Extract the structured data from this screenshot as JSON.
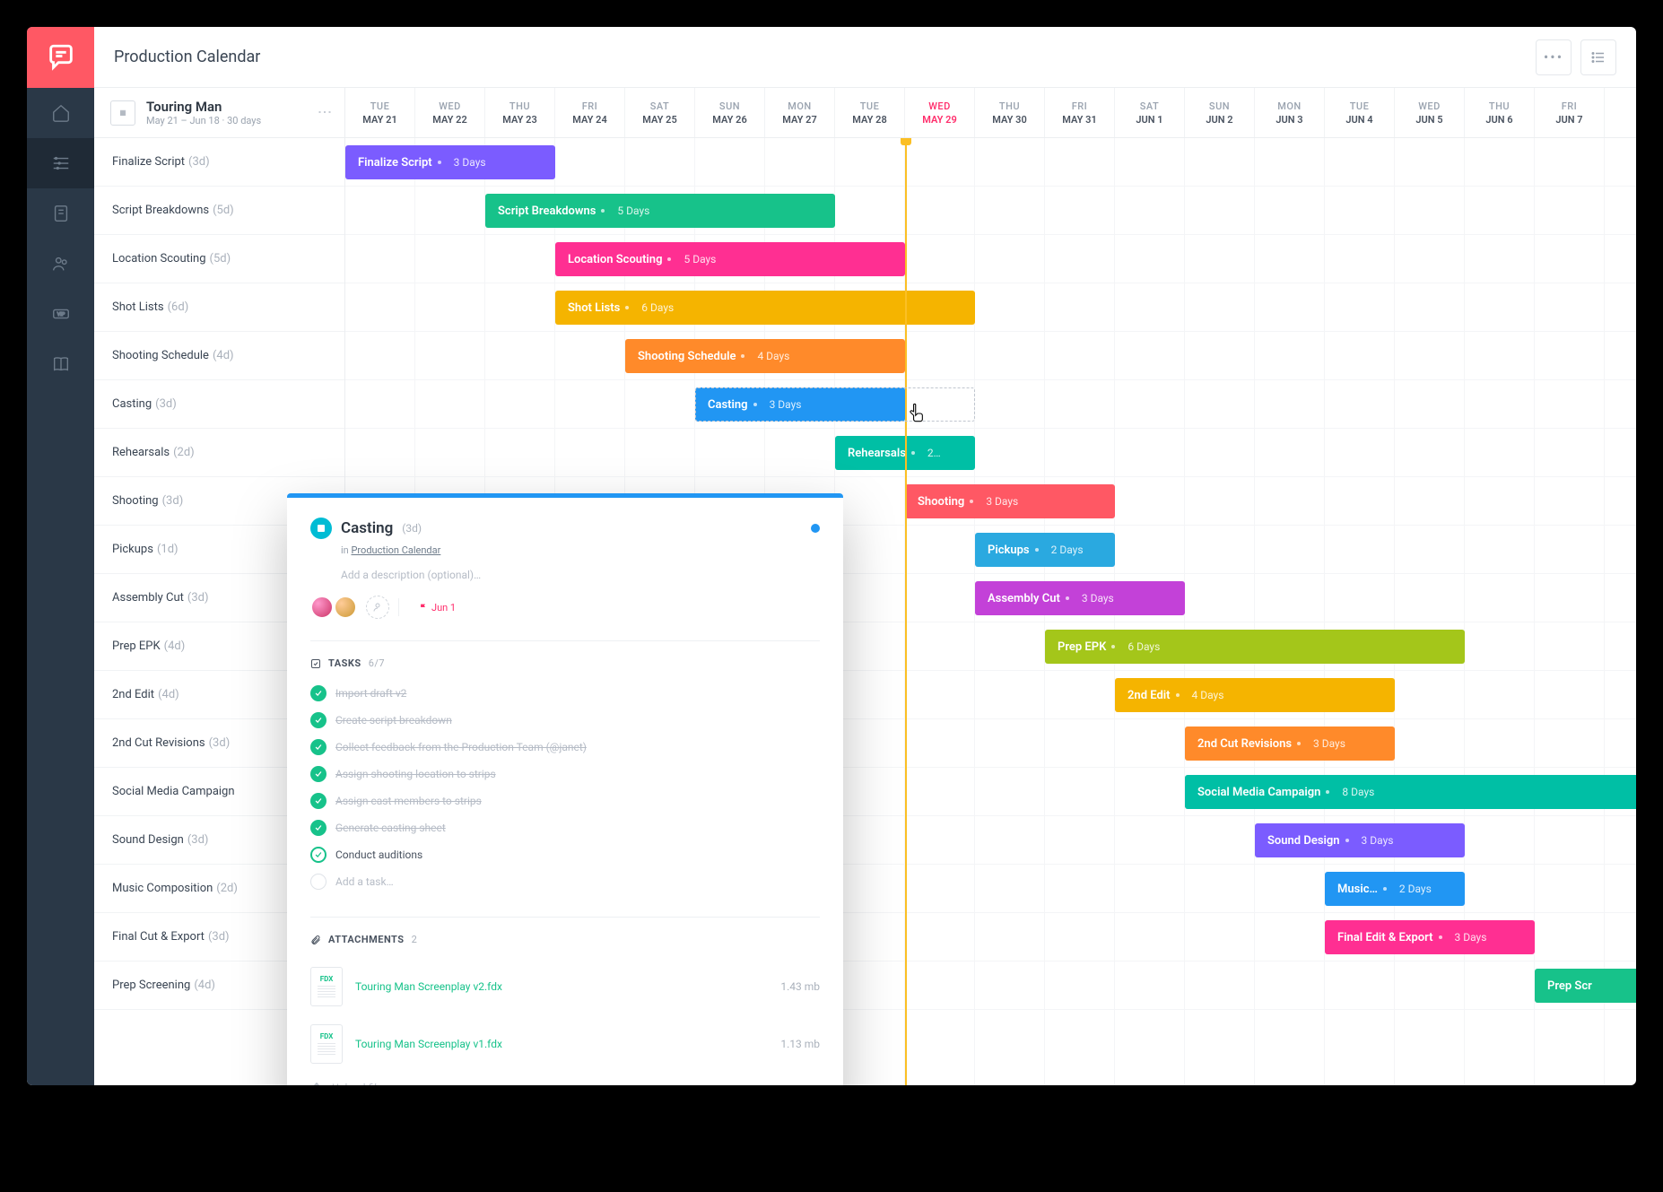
{
  "header": {
    "title": "Production Calendar"
  },
  "project": {
    "name": "Touring Man",
    "subtitle": "May 21 – Jun 18  ·  30 days"
  },
  "dates": [
    {
      "dow": "TUE",
      "md": "MAY 21",
      "current": false
    },
    {
      "dow": "WED",
      "md": "MAY 22",
      "current": false
    },
    {
      "dow": "THU",
      "md": "MAY 23",
      "current": false
    },
    {
      "dow": "FRI",
      "md": "MAY 24",
      "current": false
    },
    {
      "dow": "SAT",
      "md": "MAY 25",
      "current": false
    },
    {
      "dow": "SUN",
      "md": "MAY 26",
      "current": false
    },
    {
      "dow": "MON",
      "md": "MAY 27",
      "current": false
    },
    {
      "dow": "TUE",
      "md": "MAY 28",
      "current": false
    },
    {
      "dow": "WED",
      "md": "MAY 29",
      "current": true
    },
    {
      "dow": "THU",
      "md": "MAY 30",
      "current": false
    },
    {
      "dow": "FRI",
      "md": "MAY 31",
      "current": false
    },
    {
      "dow": "SAT",
      "md": "JUN 1",
      "current": false
    },
    {
      "dow": "SUN",
      "md": "JUN 2",
      "current": false
    },
    {
      "dow": "MON",
      "md": "JUN 3",
      "current": false
    },
    {
      "dow": "TUE",
      "md": "JUN 4",
      "current": false
    },
    {
      "dow": "WED",
      "md": "JUN 5",
      "current": false
    },
    {
      "dow": "THU",
      "md": "JUN 6",
      "current": false
    },
    {
      "dow": "FRI",
      "md": "JUN 7",
      "current": false
    }
  ],
  "tasks": [
    {
      "name": "Finalize Script",
      "dur": "(3d)",
      "bar_dur": "3 Days",
      "start": 0,
      "span": 3,
      "color": "#7b5cff"
    },
    {
      "name": "Script Breakdowns",
      "dur": "(5d)",
      "bar_dur": "5 Days",
      "start": 2,
      "span": 5,
      "color": "#17c28a"
    },
    {
      "name": "Location Scouting",
      "dur": "(5d)",
      "bar_dur": "5 Days",
      "start": 3,
      "span": 5,
      "color": "#ff2f92"
    },
    {
      "name": "Shot Lists",
      "dur": "(6d)",
      "bar_dur": "6 Days",
      "start": 3,
      "span": 6,
      "color": "#f5b400"
    },
    {
      "name": "Shooting Schedule",
      "dur": "(4d)",
      "bar_dur": "4 Days",
      "start": 4,
      "span": 4,
      "color": "#ff8a2a"
    },
    {
      "name": "Casting",
      "dur": "(3d)",
      "bar_dur": "3 Days",
      "start": 5,
      "span": 3,
      "color": "#2196f3"
    },
    {
      "name": "Rehearsals",
      "dur": "(2d)",
      "bar_dur": "2…",
      "start": 7,
      "span": 2,
      "color": "#00bfa5"
    },
    {
      "name": "Shooting",
      "dur": "(3d)",
      "bar_dur": "3 Days",
      "start": 8,
      "span": 3,
      "color": "#ff5864"
    },
    {
      "name": "Pickups",
      "dur": "(1d)",
      "bar_dur": "2 Days",
      "start": 9,
      "span": 2,
      "color": "#2aa9e0"
    },
    {
      "name": "Assembly Cut",
      "dur": "(3d)",
      "bar_dur": "3 Days",
      "start": 9,
      "span": 3,
      "color": "#c341d8"
    },
    {
      "name": "Prep EPK",
      "dur": "(4d)",
      "bar_dur": "6 Days",
      "start": 10,
      "span": 6,
      "color": "#a4c61a"
    },
    {
      "name": "2nd Edit",
      "dur": "(4d)",
      "bar_dur": "4 Days",
      "start": 11,
      "span": 4,
      "color": "#f5b400"
    },
    {
      "name": "2nd Cut Revisions",
      "dur": "(3d)",
      "bar_dur": "3 Days",
      "start": 12,
      "span": 3,
      "color": "#ff8a2a"
    },
    {
      "name": "Social Media Campaign",
      "dur": "",
      "bar_dur": "8 Days",
      "start": 12,
      "span": 8,
      "color": "#00bfa5"
    },
    {
      "name": "Sound Design",
      "dur": "(3d)",
      "bar_dur": "3 Days",
      "start": 13,
      "span": 3,
      "color": "#7b5cff"
    },
    {
      "name": "Music Composition",
      "dur": "(2d)",
      "bar_label": "Music…",
      "bar_dur": "2 Days",
      "start": 14,
      "span": 2,
      "color": "#2196f3"
    },
    {
      "name": "Final Cut & Export",
      "dur": "(3d)",
      "bar_label": "Final Edit & Export",
      "bar_dur": "3 Days",
      "start": 14,
      "span": 3,
      "color": "#ff2f92"
    },
    {
      "name": "Prep Screening",
      "dur": "(4d)",
      "bar_label": "Prep Scr",
      "bar_dur": "",
      "start": 17,
      "span": 4,
      "color": "#17c28a"
    }
  ],
  "panel": {
    "title": "Casting",
    "dur": "(3d)",
    "in_label": "in",
    "in_link": "Production Calendar",
    "desc_placeholder": "Add a description (optional)…",
    "due": "Jun 1",
    "tasks_label": "TASKS",
    "tasks_count": "6/7",
    "subtasks": [
      {
        "text": "Import draft v2",
        "done": true
      },
      {
        "text": "Create script breakdown",
        "done": true
      },
      {
        "text": "Collect feedback from the Production Team (@janet)",
        "done": true
      },
      {
        "text": "Assign shooting location to strips",
        "done": true
      },
      {
        "text": "Assign cast members to strips",
        "done": true
      },
      {
        "text": "Generate casting sheet",
        "done": true
      },
      {
        "text": "Conduct auditions",
        "done": false
      }
    ],
    "add_task_placeholder": "Add a task…",
    "attachments_label": "ATTACHMENTS",
    "attachments_count": "2",
    "attachments": [
      {
        "ext": "FDX",
        "name": "Touring Man Screenplay v2.fdx",
        "size": "1.43 mb"
      },
      {
        "ext": "FDX",
        "name": "Touring Man Screenplay v1.fdx",
        "size": "1.13 mb"
      }
    ],
    "upload_placeholder": "Upload file…"
  },
  "chart_data": {
    "type": "gantt",
    "title": "Production Calendar",
    "start_date": "May 21",
    "end_date": "Jun 18",
    "today": "May 29",
    "unit": "days",
    "rows": [
      {
        "name": "Finalize Script",
        "start": "May 21",
        "duration_days": 3,
        "color": "#7b5cff"
      },
      {
        "name": "Script Breakdowns",
        "start": "May 23",
        "duration_days": 5,
        "color": "#17c28a"
      },
      {
        "name": "Location Scouting",
        "start": "May 24",
        "duration_days": 5,
        "color": "#ff2f92"
      },
      {
        "name": "Shot Lists",
        "start": "May 24",
        "duration_days": 6,
        "color": "#f5b400"
      },
      {
        "name": "Shooting Schedule",
        "start": "May 25",
        "duration_days": 4,
        "color": "#ff8a2a"
      },
      {
        "name": "Casting",
        "start": "May 26",
        "duration_days": 3,
        "color": "#2196f3"
      },
      {
        "name": "Rehearsals",
        "start": "May 28",
        "duration_days": 2,
        "color": "#00bfa5"
      },
      {
        "name": "Shooting",
        "start": "May 29",
        "duration_days": 3,
        "color": "#ff5864"
      },
      {
        "name": "Pickups",
        "start": "May 30",
        "duration_days": 2,
        "color": "#2aa9e0"
      },
      {
        "name": "Assembly Cut",
        "start": "May 30",
        "duration_days": 3,
        "color": "#c341d8"
      },
      {
        "name": "Prep EPK",
        "start": "May 31",
        "duration_days": 6,
        "color": "#a4c61a"
      },
      {
        "name": "2nd Edit",
        "start": "Jun 1",
        "duration_days": 4,
        "color": "#f5b400"
      },
      {
        "name": "2nd Cut Revisions",
        "start": "Jun 2",
        "duration_days": 3,
        "color": "#ff8a2a"
      },
      {
        "name": "Social Media Campaign",
        "start": "Jun 2",
        "duration_days": 8,
        "color": "#00bfa5"
      },
      {
        "name": "Sound Design",
        "start": "Jun 3",
        "duration_days": 3,
        "color": "#7b5cff"
      },
      {
        "name": "Music Composition",
        "start": "Jun 4",
        "duration_days": 2,
        "color": "#2196f3"
      },
      {
        "name": "Final Edit & Export",
        "start": "Jun 4",
        "duration_days": 3,
        "color": "#ff2f92"
      },
      {
        "name": "Prep Screening",
        "start": "Jun 7",
        "duration_days": 4,
        "color": "#17c28a"
      }
    ]
  }
}
